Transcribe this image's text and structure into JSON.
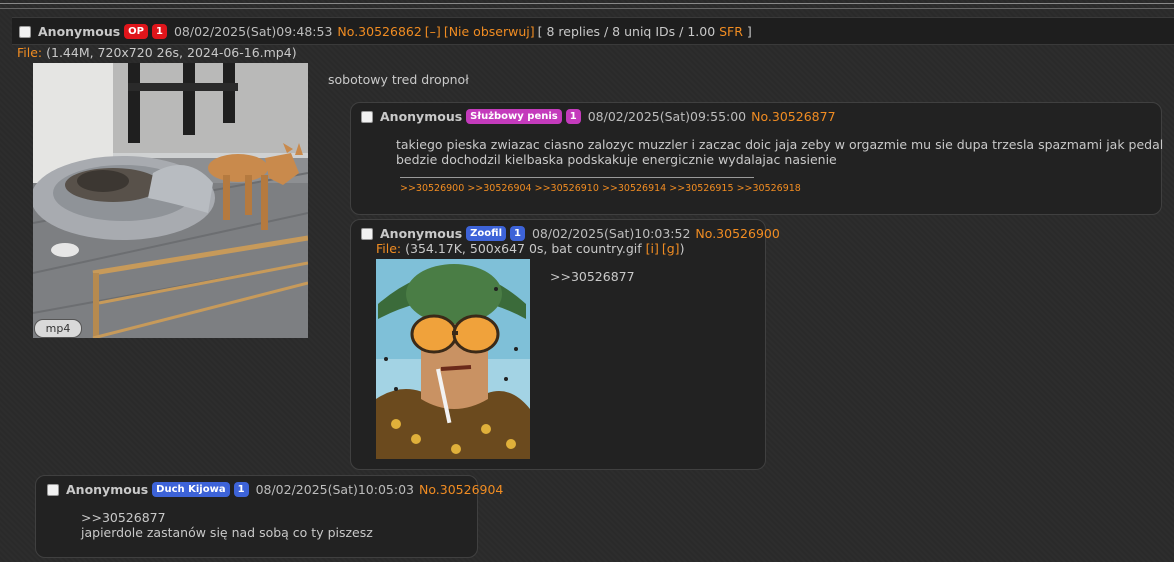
{
  "op": {
    "name": "Anonymous",
    "badge": "OP",
    "count": "1",
    "date": "08/02/2025(Sat)09:48:53",
    "post_no": "No.30526862",
    "collapse": "[–]",
    "watch": "[Nie obserwuj]",
    "stats_prefix": "[ 8 replies / 8 uniq IDs / 1.00 ",
    "sfr": "SFR",
    "stats_suffix": " ]",
    "file_label": "File:",
    "file_info": " (1.44M, 720x720 26s, 2024-06-16.mp4)",
    "media_badge": "mp4",
    "text": "sobotowy tred dropnoł"
  },
  "replies": [
    {
      "name": "Anonymous",
      "badge": "Służbowy penis",
      "count": "1",
      "date": "08/02/2025(Sat)09:55:00",
      "post_no": "No.30526877",
      "lines": [
        "takiego pieska zwiazac ciasno zalozyc muzzler i zaczac doic jaja zeby w orgazmie mu sie dupa trzesla spazmami jak pedal",
        "bedzie dochodzil kielbaska podskakuje energicznie wydalajac nasienie"
      ],
      "backlinks": [
        ">>30526900",
        ">>30526904",
        ">>30526910",
        ">>30526914",
        ">>30526915",
        ">>30526918"
      ]
    },
    {
      "name": "Anonymous",
      "badge": "Zoofil",
      "count": "1",
      "date": "08/02/2025(Sat)10:03:52",
      "post_no": "No.30526900",
      "file_label": "File:",
      "file_info": " (354.17K, 500x647 0s, bat country.gif ",
      "file_i": "[i]",
      "file_g": "[g]",
      "file_close": ")",
      "quote": ">>30526877"
    },
    {
      "name": "Anonymous",
      "badge": "Duch Kijowa",
      "count": "1",
      "date": "08/02/2025(Sat)10:05:03",
      "post_no": "No.30526904",
      "quote": ">>30526877",
      "text": "japierdole zastanów się nad sobą co ty piszesz"
    }
  ],
  "colors": {
    "accent": "#f08c22",
    "op_badge": "#e0151b",
    "pink_badge": "#c43bbc",
    "blue_badge": "#3d63d8"
  },
  "icons": [
    "checkbox",
    "mp4-badge"
  ]
}
